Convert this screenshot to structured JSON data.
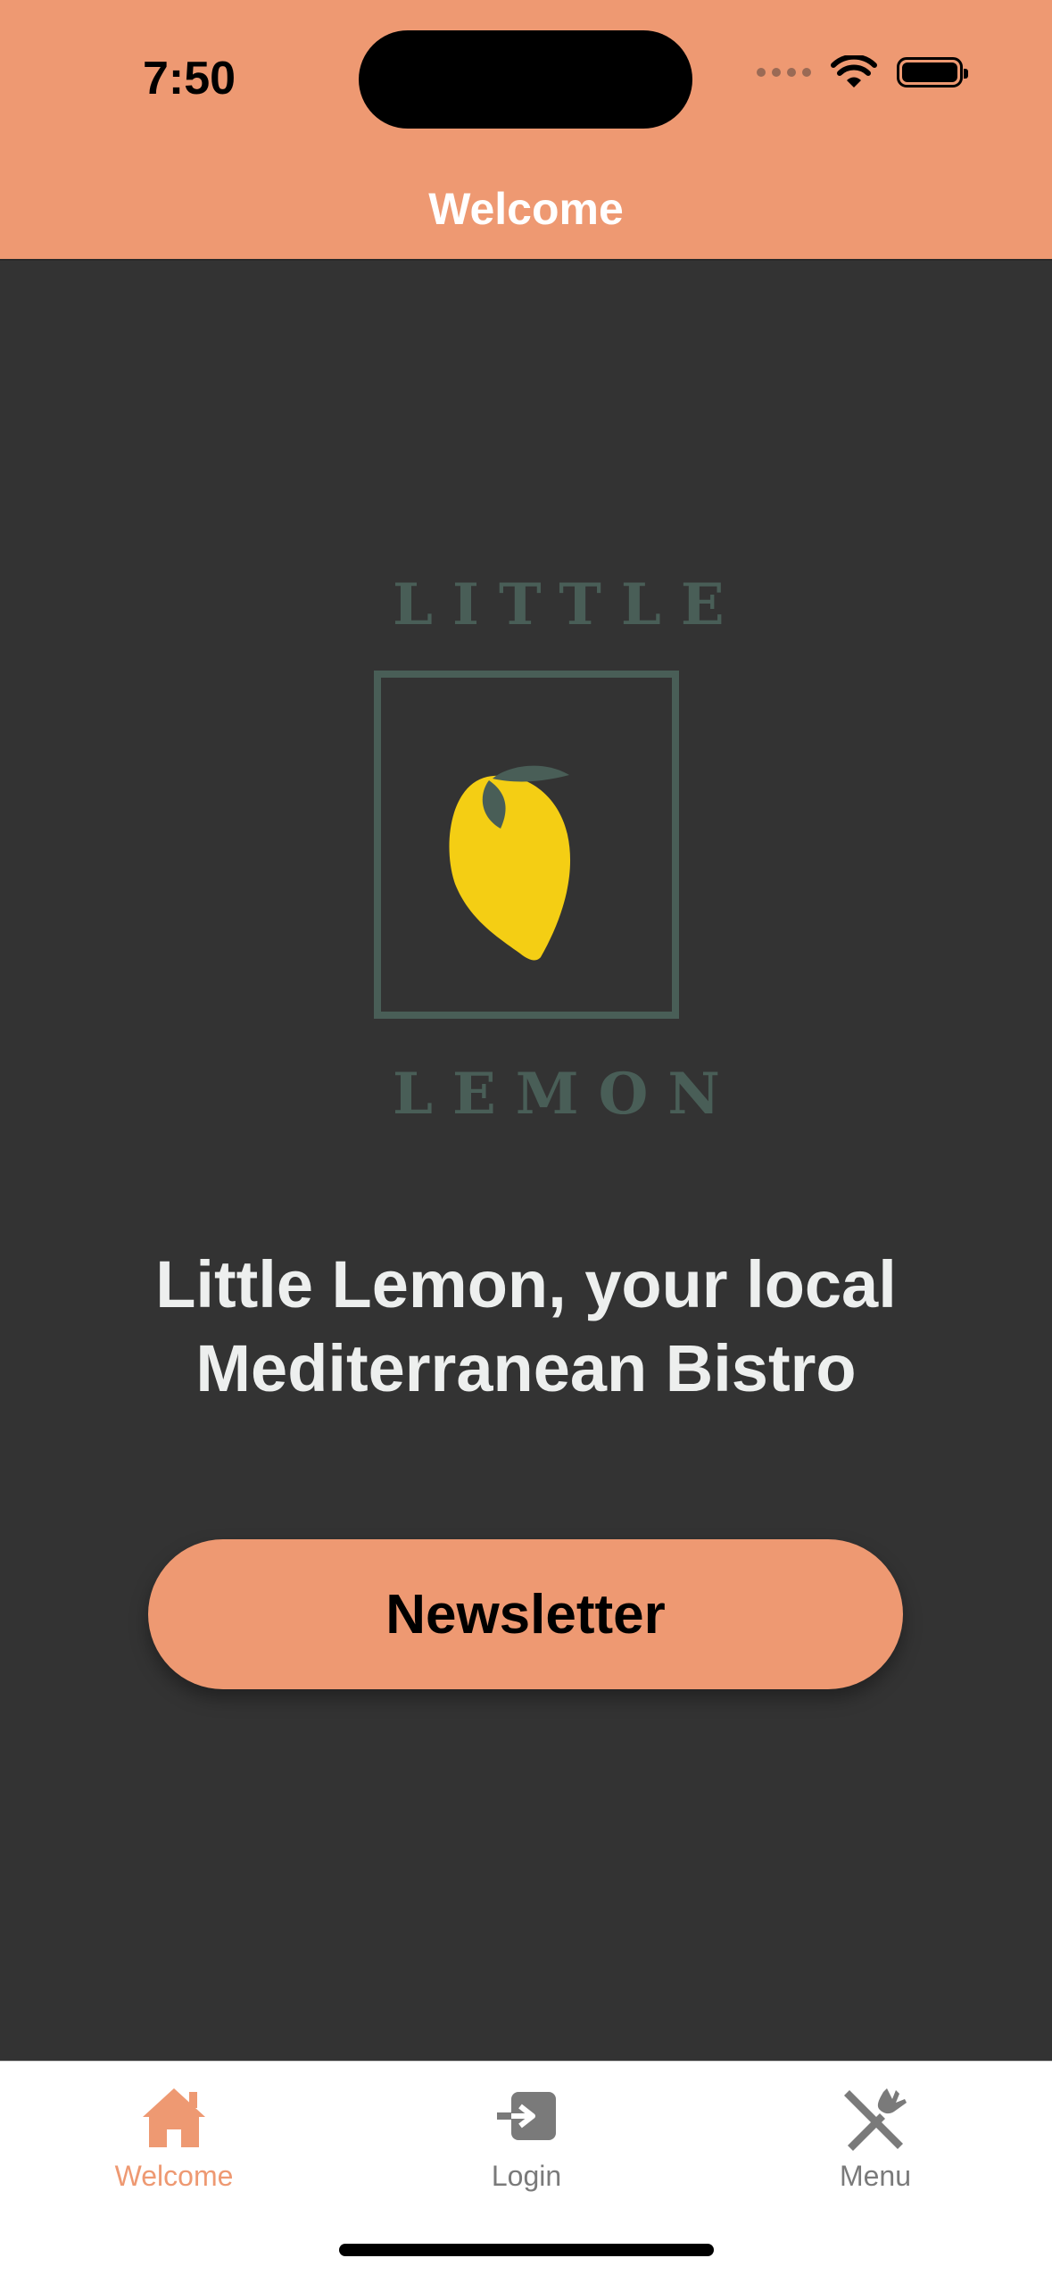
{
  "status_bar": {
    "time": "7:50"
  },
  "header": {
    "title": "Welcome"
  },
  "logo": {
    "top_text": "LITTLE",
    "bottom_text": "LEMON",
    "brand_color": "#495E57",
    "lemon_color": "#F4CE14"
  },
  "main": {
    "tagline_line1": "Little Lemon, your local",
    "tagline_line2": "Mediterranean Bistro",
    "newsletter_label": "Newsletter"
  },
  "tabs": [
    {
      "label": "Welcome",
      "icon": "home-icon",
      "active": true
    },
    {
      "label": "Login",
      "icon": "login-icon",
      "active": false
    },
    {
      "label": "Menu",
      "icon": "cutlery-icon",
      "active": false
    }
  ],
  "colors": {
    "accent": "#EE9972",
    "background": "#333333",
    "inactive": "#7a7a7a"
  }
}
